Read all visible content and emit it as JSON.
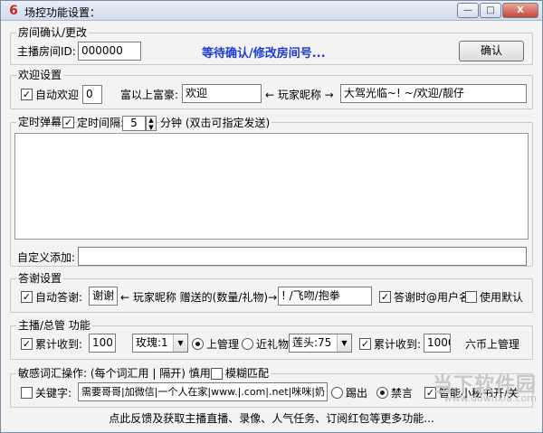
{
  "window": {
    "title": "场控功能设置：",
    "app_icon": "6",
    "minimize_icon": "—",
    "maximize_icon": "□",
    "close_icon": "X"
  },
  "room": {
    "group_title": "房间确认/更改",
    "id_label": "主播房间ID:",
    "id_value": "000000",
    "status": "等待确认/修改房间号...",
    "confirm_label": "确认"
  },
  "welcome": {
    "group_title": "欢迎设置",
    "auto_label": "自动欢迎",
    "auto_checked": true,
    "count_value": "0",
    "vip_label": "富以上富豪:",
    "vip_value": "欢迎",
    "nickname_label": "← 玩家昵称 →",
    "suffix_value": "大驾光临~! ~/欢迎/靓仔"
  },
  "timer": {
    "group_title": "定时弹幕",
    "enabled_checked": true,
    "interval_label": "定时间隔:",
    "interval_value": "5",
    "minutes_hint": "分钟  (双击可指定发送)",
    "custom_add_label": "自定义添加:"
  },
  "thanks": {
    "group_title": "答谢设置",
    "auto_label": "自动答谢:",
    "auto_checked": true,
    "prefix_value": "谢谢",
    "middle_label": "← 玩家昵称  赠送的(数量/礼物)→",
    "suffix_value": "! /飞吻/抱拳",
    "at_user_label": "答谢时@用户名",
    "at_user_checked": true,
    "default_label": "使用默认",
    "default_checked": false
  },
  "admin": {
    "group_title": "主播/总管  功能",
    "accum1_label": "累计收到:",
    "accum1_checked": true,
    "accum1_value": "100",
    "gift_select": "玫瑰:1",
    "upper_admin_label": "上管理",
    "upper_admin_selected": true,
    "near_gift_label": "近礼物",
    "near_gift_selected": false,
    "fan_select": "莲头:75",
    "accum2_label": "累计收到:",
    "accum2_checked": true,
    "accum2_value": "1000",
    "coin_label": "六币上管理"
  },
  "sensitive": {
    "group_title": "敏感词汇操作: (每个词汇用 | 隔开) 慎用",
    "fuzzy_label": "模糊匹配",
    "fuzzy_checked": false,
    "keyword_label": "关键字:",
    "keyword_checked": false,
    "keyword_value": "需要哥哥|加微信|一个人在家|www.|.com|.net|咪咪|奶",
    "kick_label": "踢出",
    "kick_selected": false,
    "mute_label": "禁言",
    "mute_selected": true,
    "assistant_label": "智能小秘书开/关",
    "assistant_checked": true
  },
  "footer": {
    "text": "点此反馈及获取主播直播、录像、人气任务、订阅红包等更多功能..."
  },
  "watermark": {
    "brand": "当下软件园",
    "url": "www.downxia.com"
  }
}
